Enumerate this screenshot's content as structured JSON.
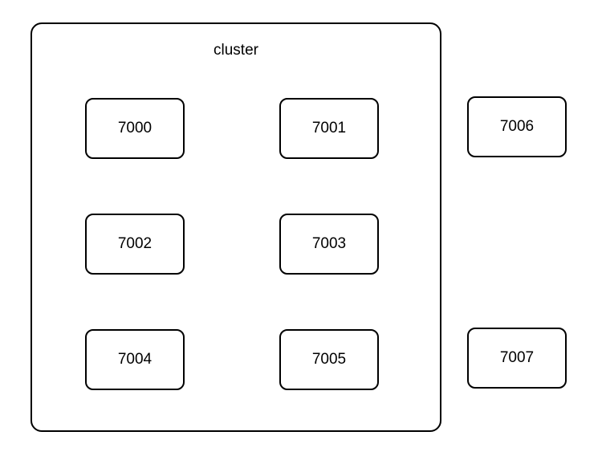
{
  "cluster": {
    "title": "cluster",
    "nodes": [
      {
        "label": "7000"
      },
      {
        "label": "7001"
      },
      {
        "label": "7002"
      },
      {
        "label": "7003"
      },
      {
        "label": "7004"
      },
      {
        "label": "7005"
      }
    ]
  },
  "external_nodes": [
    {
      "label": "7006"
    },
    {
      "label": "7007"
    }
  ]
}
